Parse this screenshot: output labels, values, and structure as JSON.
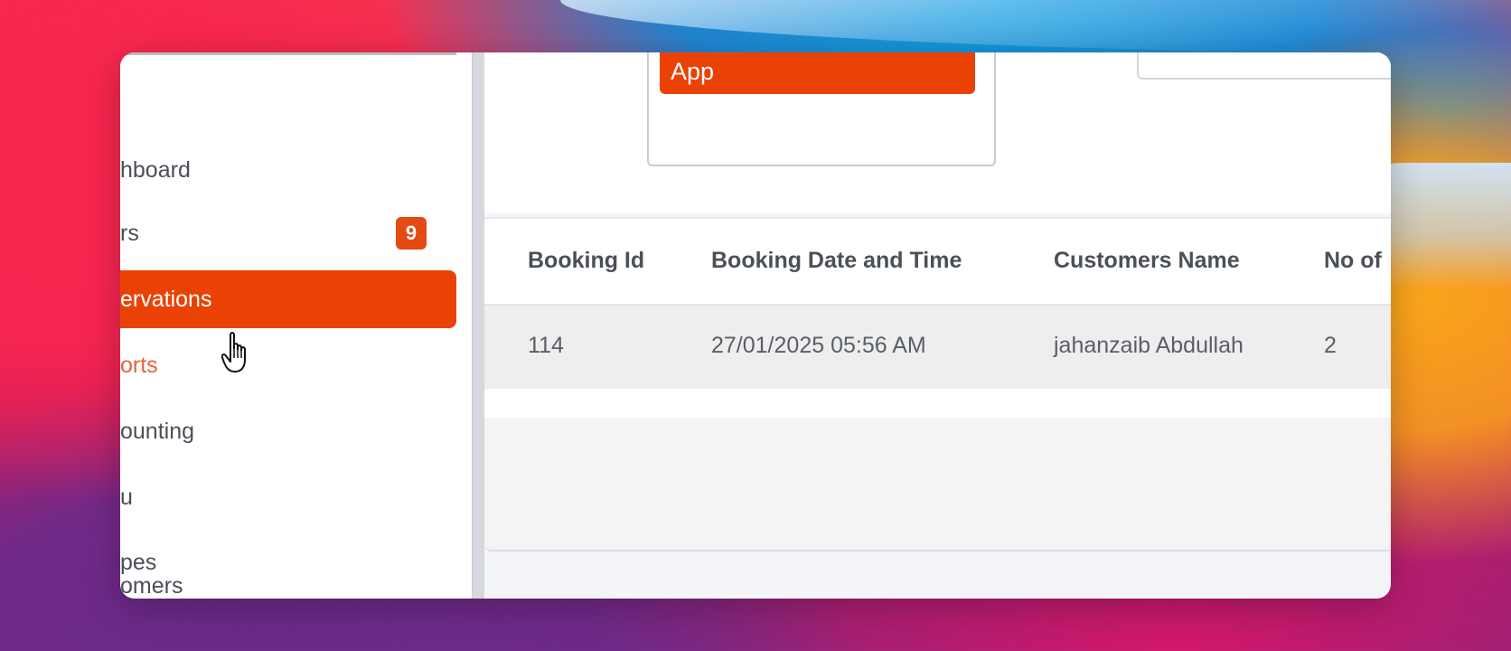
{
  "sidebar": {
    "items": [
      {
        "label": "hboard",
        "state": "normal"
      },
      {
        "label": "rs",
        "state": "normal",
        "badge": "9"
      },
      {
        "label": "ervations",
        "state": "active"
      },
      {
        "label": "orts",
        "state": "accent"
      },
      {
        "label": "ounting",
        "state": "normal"
      },
      {
        "label": "u",
        "state": "normal"
      },
      {
        "label": "pes",
        "state": "normal"
      },
      {
        "label": "omers",
        "state": "normal"
      }
    ]
  },
  "top": {
    "app_button_label": "App"
  },
  "table": {
    "headers": [
      "Booking Id",
      "Booking Date and Time",
      "Customers Name",
      "No of"
    ],
    "rows": [
      [
        "114",
        "27/01/2025 05:56 AM",
        "jahanzaib Abdullah",
        "2"
      ]
    ]
  },
  "colors": {
    "accent": "#ea4205",
    "badge": "#e44a12"
  },
  "icons": {
    "cursor": "hand-pointer-icon"
  }
}
